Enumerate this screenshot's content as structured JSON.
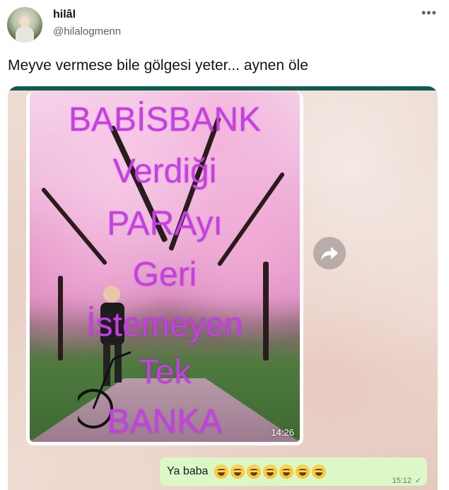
{
  "tweet": {
    "display_name": "hilâl",
    "handle": "@hilalogmenn",
    "more_icon": "more-icon",
    "text": "Meyve vermese bile gölgesi yeter... aynen öle"
  },
  "image_message": {
    "overlay_lines": [
      "BABİSBANK",
      "Verdiği",
      "PARAyı",
      "Geri",
      "İstemeyen",
      "Tek",
      "BANKA"
    ],
    "time": "14:26"
  },
  "reply_message": {
    "text": "Ya baba",
    "emoji_icon": "laughing-emoji-icon",
    "emoji_count": 7,
    "time": "15:12",
    "status": "✓"
  },
  "colors": {
    "overlay_text": "#c63ee6",
    "bubble": "#dcf8c6",
    "topbar": "#0f5b52"
  }
}
